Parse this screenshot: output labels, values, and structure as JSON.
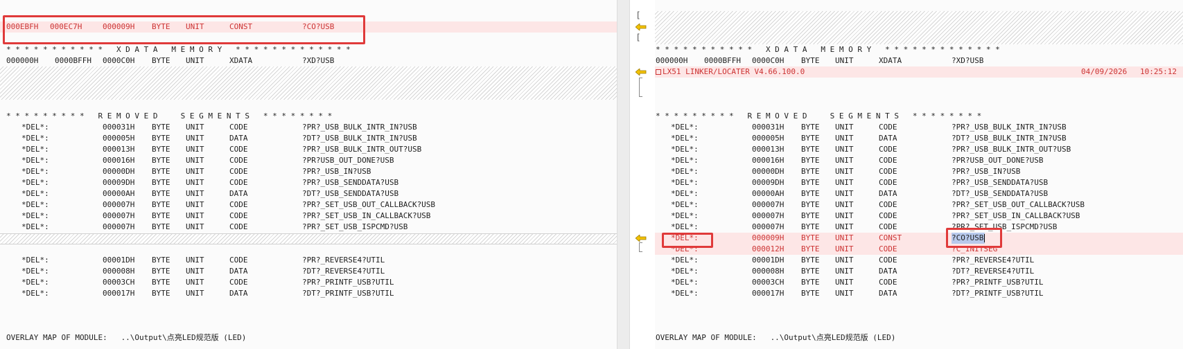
{
  "left_pane": {
    "top_segment_row": {
      "c1": "000EBFH",
      "c2": "000EC7H",
      "c3": "000009H",
      "c4": "BYTE",
      "c5": "UNIT",
      "c6": "CONST",
      "c7": "?CO?USB"
    },
    "xdata_header": "* * * * * * * * * * *   X D A T A   M E M O R Y   * * * * * * * * * * * * *",
    "xdata_row": {
      "c1": "000000H",
      "c2": "0000BFFH",
      "c3": "0000C0H",
      "c4": "BYTE",
      "c5": "UNIT",
      "c6": "XDATA",
      "c7": "?XD?USB"
    },
    "removed_header": "* * * * * * * * *   R E M O V E D     S E G M E N T S   * * * * * * * *",
    "removed_rows_a": [
      {
        "del": "*DEL*:",
        "len": "000031H",
        "t": "BYTE",
        "u": "UNIT",
        "cls": "CODE",
        "name": "?PR?_USB_BULK_INTR_IN?USB"
      },
      {
        "del": "*DEL*:",
        "len": "000005H",
        "t": "BYTE",
        "u": "UNIT",
        "cls": "DATA",
        "name": "?DT?_USB_BULK_INTR_IN?USB"
      },
      {
        "del": "*DEL*:",
        "len": "000013H",
        "t": "BYTE",
        "u": "UNIT",
        "cls": "CODE",
        "name": "?PR?_USB_BULK_INTR_OUT?USB"
      },
      {
        "del": "*DEL*:",
        "len": "000016H",
        "t": "BYTE",
        "u": "UNIT",
        "cls": "CODE",
        "name": "?PR?USB_OUT_DONE?USB"
      },
      {
        "del": "*DEL*:",
        "len": "00000DH",
        "t": "BYTE",
        "u": "UNIT",
        "cls": "CODE",
        "name": "?PR?_USB_IN?USB"
      },
      {
        "del": "*DEL*:",
        "len": "00009DH",
        "t": "BYTE",
        "u": "UNIT",
        "cls": "CODE",
        "name": "?PR?_USB_SENDDATA?USB"
      },
      {
        "del": "*DEL*:",
        "len": "00000AH",
        "t": "BYTE",
        "u": "UNIT",
        "cls": "DATA",
        "name": "?DT?_USB_SENDDATA?USB"
      },
      {
        "del": "*DEL*:",
        "len": "000007H",
        "t": "BYTE",
        "u": "UNIT",
        "cls": "CODE",
        "name": "?PR?_SET_USB_OUT_CALLBACK?USB"
      },
      {
        "del": "*DEL*:",
        "len": "000007H",
        "t": "BYTE",
        "u": "UNIT",
        "cls": "CODE",
        "name": "?PR?_SET_USB_IN_CALLBACK?USB"
      },
      {
        "del": "*DEL*:",
        "len": "000007H",
        "t": "BYTE",
        "u": "UNIT",
        "cls": "CODE",
        "name": "?PR?_SET_USB_ISPCMD?USB"
      }
    ],
    "removed_rows_b": [
      {
        "del": "*DEL*:",
        "len": "00001DH",
        "t": "BYTE",
        "u": "UNIT",
        "cls": "CODE",
        "name": "?PR?_REVERSE4?UTIL"
      },
      {
        "del": "*DEL*:",
        "len": "000008H",
        "t": "BYTE",
        "u": "UNIT",
        "cls": "DATA",
        "name": "?DT?_REVERSE4?UTIL"
      },
      {
        "del": "*DEL*:",
        "len": "00003CH",
        "t": "BYTE",
        "u": "UNIT",
        "cls": "CODE",
        "name": "?PR?_PRINTF_USB?UTIL"
      },
      {
        "del": "*DEL*:",
        "len": "000017H",
        "t": "BYTE",
        "u": "UNIT",
        "cls": "DATA",
        "name": "?DT?_PRINTF_USB?UTIL"
      }
    ],
    "overlay_line": "OVERLAY MAP OF MODULE:   ..\\Output\\点亮LED规范版 (LED)"
  },
  "right_pane": {
    "xdata_header": "* * * * * * * * * * *   X D A T A   M E M O R Y   * * * * * * * * * * * * *",
    "xdata_row": {
      "c1": "000000H",
      "c2": "0000BFFH",
      "c3": "0000C0H",
      "c4": "BYTE",
      "c5": "UNIT",
      "c6": "XDATA",
      "c7": "?XD?USB"
    },
    "linker_line": {
      "title": "LX51 LINKER/LOCATER V4.66.100.0",
      "date": "04/09/2026",
      "time": "10:25:12"
    },
    "removed_header": "* * * * * * * * *   R E M O V E D     S E G M E N T S   * * * * * * * *",
    "removed_rows_a": [
      {
        "del": "*DEL*:",
        "len": "000031H",
        "t": "BYTE",
        "u": "UNIT",
        "cls": "CODE",
        "name": "?PR?_USB_BULK_INTR_IN?USB"
      },
      {
        "del": "*DEL*:",
        "len": "000005H",
        "t": "BYTE",
        "u": "UNIT",
        "cls": "DATA",
        "name": "?DT?_USB_BULK_INTR_IN?USB"
      },
      {
        "del": "*DEL*:",
        "len": "000013H",
        "t": "BYTE",
        "u": "UNIT",
        "cls": "CODE",
        "name": "?PR?_USB_BULK_INTR_OUT?USB"
      },
      {
        "del": "*DEL*:",
        "len": "000016H",
        "t": "BYTE",
        "u": "UNIT",
        "cls": "CODE",
        "name": "?PR?USB_OUT_DONE?USB"
      },
      {
        "del": "*DEL*:",
        "len": "00000DH",
        "t": "BYTE",
        "u": "UNIT",
        "cls": "CODE",
        "name": "?PR?_USB_IN?USB"
      },
      {
        "del": "*DEL*:",
        "len": "00009DH",
        "t": "BYTE",
        "u": "UNIT",
        "cls": "CODE",
        "name": "?PR?_USB_SENDDATA?USB"
      },
      {
        "del": "*DEL*:",
        "len": "00000AH",
        "t": "BYTE",
        "u": "UNIT",
        "cls": "DATA",
        "name": "?DT?_USB_SENDDATA?USB"
      },
      {
        "del": "*DEL*:",
        "len": "000007H",
        "t": "BYTE",
        "u": "UNIT",
        "cls": "CODE",
        "name": "?PR?_SET_USB_OUT_CALLBACK?USB"
      },
      {
        "del": "*DEL*:",
        "len": "000007H",
        "t": "BYTE",
        "u": "UNIT",
        "cls": "CODE",
        "name": "?PR?_SET_USB_IN_CALLBACK?USB"
      },
      {
        "del": "*DEL*:",
        "len": "000007H",
        "t": "BYTE",
        "u": "UNIT",
        "cls": "CODE",
        "name": "?PR?_SET_USB_ISPCMD?USB"
      }
    ],
    "added_rows": [
      {
        "del": "*DEL*:",
        "len": "000009H",
        "t": "BYTE",
        "u": "UNIT",
        "cls": "CONST",
        "name": "?CO?USB"
      },
      {
        "del": "*DEL*:",
        "len": "000012H",
        "t": "BYTE",
        "u": "UNIT",
        "cls": "CODE",
        "name": "?C_INITSEG"
      }
    ],
    "removed_rows_b": [
      {
        "del": "*DEL*:",
        "len": "00001DH",
        "t": "BYTE",
        "u": "UNIT",
        "cls": "CODE",
        "name": "?PR?_REVERSE4?UTIL"
      },
      {
        "del": "*DEL*:",
        "len": "000008H",
        "t": "BYTE",
        "u": "UNIT",
        "cls": "DATA",
        "name": "?DT?_REVERSE4?UTIL"
      },
      {
        "del": "*DEL*:",
        "len": "00003CH",
        "t": "BYTE",
        "u": "UNIT",
        "cls": "CODE",
        "name": "?PR?_PRINTF_USB?UTIL"
      },
      {
        "del": "*DEL*:",
        "len": "000017H",
        "t": "BYTE",
        "u": "UNIT",
        "cls": "DATA",
        "name": "?DT?_PRINTF_USB?UTIL"
      }
    ],
    "overlay_line": "OVERLAY MAP OF MODULE:   ..\\Output\\点亮LED规范版 (LED)"
  },
  "gutter_icons": [
    "left-bracket-icon",
    "yellow-arrow-icon"
  ],
  "colors": {
    "changed_bg": "#fde6e6",
    "removed_text": "#cc3333",
    "highlight_box": "#e03a3a",
    "arrow": "#e8b400"
  }
}
